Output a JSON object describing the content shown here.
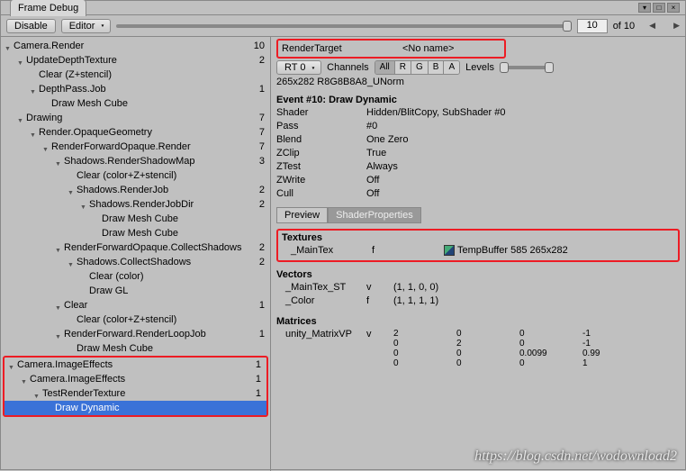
{
  "window": {
    "title": "Frame Debug"
  },
  "toolbar": {
    "disable": "Disable",
    "editor": "Editor",
    "current": "10",
    "of_label": "of 10",
    "arrow_left": "◀",
    "arrow_right": "▶"
  },
  "tree": [
    {
      "indent": 0,
      "arrow": true,
      "label": "Camera.Render",
      "count": "10"
    },
    {
      "indent": 1,
      "arrow": true,
      "label": "UpdateDepthTexture",
      "count": "2"
    },
    {
      "indent": 2,
      "arrow": false,
      "label": "Clear (Z+stencil)",
      "count": ""
    },
    {
      "indent": 2,
      "arrow": true,
      "label": "DepthPass.Job",
      "count": "1"
    },
    {
      "indent": 3,
      "arrow": false,
      "label": "Draw Mesh Cube",
      "count": ""
    },
    {
      "indent": 1,
      "arrow": true,
      "label": "Drawing",
      "count": "7"
    },
    {
      "indent": 2,
      "arrow": true,
      "label": "Render.OpaqueGeometry",
      "count": "7"
    },
    {
      "indent": 3,
      "arrow": true,
      "label": "RenderForwardOpaque.Render",
      "count": "7"
    },
    {
      "indent": 4,
      "arrow": true,
      "label": "Shadows.RenderShadowMap",
      "count": "3"
    },
    {
      "indent": 5,
      "arrow": false,
      "label": "Clear (color+Z+stencil)",
      "count": ""
    },
    {
      "indent": 5,
      "arrow": true,
      "label": "Shadows.RenderJob",
      "count": "2"
    },
    {
      "indent": 6,
      "arrow": true,
      "label": "Shadows.RenderJobDir",
      "count": "2"
    },
    {
      "indent": 7,
      "arrow": false,
      "label": "Draw Mesh Cube",
      "count": ""
    },
    {
      "indent": 7,
      "arrow": false,
      "label": "Draw Mesh Cube",
      "count": ""
    },
    {
      "indent": 4,
      "arrow": true,
      "label": "RenderForwardOpaque.CollectShadows",
      "count": "2"
    },
    {
      "indent": 5,
      "arrow": true,
      "label": "Shadows.CollectShadows",
      "count": "2"
    },
    {
      "indent": 6,
      "arrow": false,
      "label": "Clear (color)",
      "count": ""
    },
    {
      "indent": 6,
      "arrow": false,
      "label": "Draw GL",
      "count": ""
    },
    {
      "indent": 4,
      "arrow": true,
      "label": "Clear",
      "count": "1"
    },
    {
      "indent": 5,
      "arrow": false,
      "label": "Clear (color+Z+stencil)",
      "count": ""
    },
    {
      "indent": 4,
      "arrow": true,
      "label": "RenderForward.RenderLoopJob",
      "count": "1"
    },
    {
      "indent": 5,
      "arrow": false,
      "label": "Draw Mesh Cube",
      "count": ""
    },
    {
      "indent": 0,
      "arrow": true,
      "label": "Camera.ImageEffects",
      "count": "1",
      "redtop": true
    },
    {
      "indent": 1,
      "arrow": true,
      "label": "Camera.ImageEffects",
      "count": "1"
    },
    {
      "indent": 2,
      "arrow": true,
      "label": "TestRenderTexture",
      "count": "1"
    },
    {
      "indent": 3,
      "arrow": false,
      "label": "Draw Dynamic",
      "count": "",
      "selected": true,
      "redbot": true
    }
  ],
  "detail": {
    "rtlabel": "RenderTarget",
    "rtname": "<No name>",
    "rt_dd": "RT 0",
    "channels_label": "Channels",
    "channels": [
      "All",
      "R",
      "G",
      "B",
      "A"
    ],
    "levels_label": "Levels",
    "res": "265x282 R8G8B8A8_UNorm",
    "event_title": "Event #10: Draw Dynamic",
    "props": [
      {
        "k": "Shader",
        "v": "Hidden/BlitCopy, SubShader #0"
      },
      {
        "k": "Pass",
        "v": "#0"
      },
      {
        "k": "Blend",
        "v": "One Zero"
      },
      {
        "k": "ZClip",
        "v": "True"
      },
      {
        "k": "ZTest",
        "v": "Always"
      },
      {
        "k": "ZWrite",
        "v": "Off"
      },
      {
        "k": "Cull",
        "v": "Off"
      }
    ],
    "tab_preview": "Preview",
    "tab_shaderprops": "ShaderProperties",
    "sec_textures": "Textures",
    "tex_name": "_MainTex",
    "tex_type": "f",
    "tex_val": "TempBuffer 585 265x282",
    "sec_vectors": "Vectors",
    "vectors": [
      {
        "name": "_MainTex_ST",
        "t": "v",
        "val": "(1, 1, 0, 0)"
      },
      {
        "name": "_Color",
        "t": "f",
        "val": "(1, 1, 1, 1)"
      }
    ],
    "sec_matrices": "Matrices",
    "mat_name": "unity_MatrixVP",
    "mat_t": "v",
    "matrix": [
      [
        "2",
        "0",
        "0",
        "-1"
      ],
      [
        "0",
        "2",
        "0",
        "-1"
      ],
      [
        "0",
        "0",
        "0.0099",
        "0.99"
      ],
      [
        "0",
        "0",
        "0",
        "1"
      ]
    ]
  },
  "watermark": "https://blog.csdn.net/wodownload2"
}
